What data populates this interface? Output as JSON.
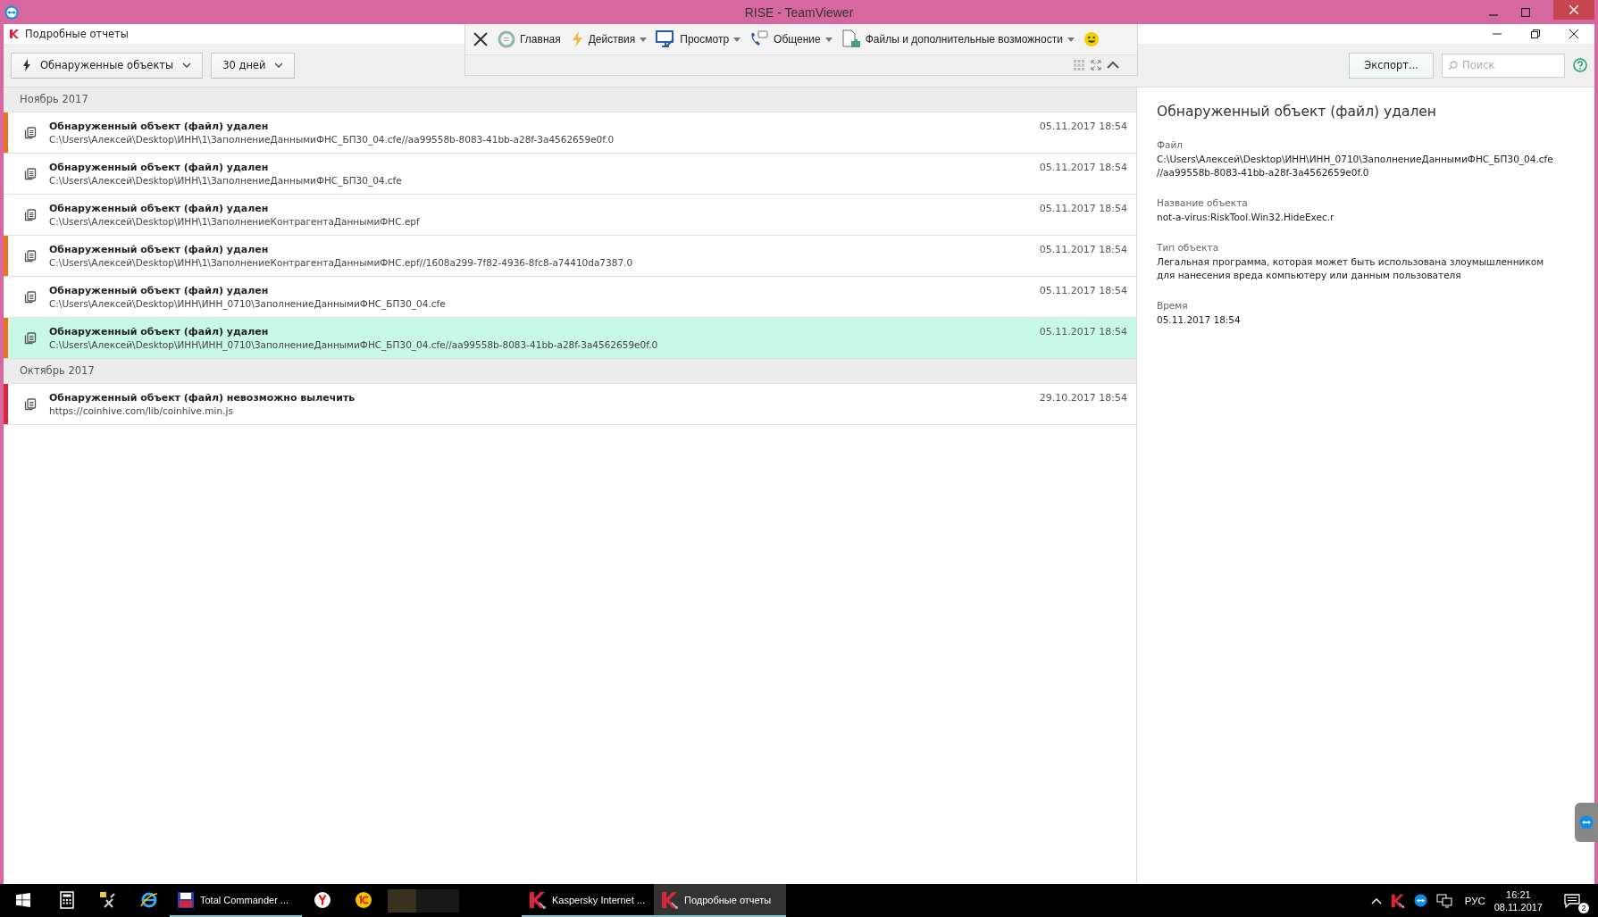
{
  "window": {
    "title": "RISE - TeamViewer"
  },
  "app": {
    "title": "Подробные отчеты"
  },
  "teamviewer_toolbar": {
    "items": [
      {
        "kind": "close"
      },
      {
        "kind": "home",
        "label": "Главная",
        "dropdown": false
      },
      {
        "kind": "actions",
        "label": "Действия",
        "dropdown": true
      },
      {
        "kind": "view",
        "label": "Просмотр",
        "dropdown": true
      },
      {
        "kind": "communicate",
        "label": "Общение",
        "dropdown": true
      },
      {
        "kind": "files",
        "label": "Файлы и дополнительные возможности",
        "dropdown": true
      },
      {
        "kind": "smiley"
      }
    ]
  },
  "filters": [
    {
      "kind": "type",
      "label": "Обнаруженные объекты"
    },
    {
      "kind": "period",
      "label": "30 дней"
    }
  ],
  "export_button": "Экспорт...",
  "search": {
    "placeholder": "Поиск"
  },
  "groups": [
    {
      "title": "Ноябрь 2017",
      "events": [
        {
          "title": "Обнаруженный объект (файл) удален",
          "path": "C:\\Users\\Алексей\\Desktop\\ИНН\\1\\ЗаполнениеДаннымиФНС_БП30_04.cfe//aa99558b-8083-41bb-a28f-3a4562659e0f.0",
          "time": "05.11.2017 18:54",
          "color": "#e8731a",
          "selected": false
        },
        {
          "title": "Обнаруженный объект (файл) удален",
          "path": "C:\\Users\\Алексей\\Desktop\\ИНН\\1\\ЗаполнениеДаннымиФНС_БП30_04.cfe",
          "time": "05.11.2017 18:54",
          "selected": false
        },
        {
          "title": "Обнаруженный объект (файл) удален",
          "path": "C:\\Users\\Алексей\\Desktop\\ИНН\\1\\ЗаполнениеКонтрагентаДаннымиФНС.epf",
          "time": "05.11.2017 18:54",
          "selected": false
        },
        {
          "title": "Обнаруженный объект (файл) удален",
          "path": "C:\\Users\\Алексей\\Desktop\\ИНН\\1\\ЗаполнениеКонтрагентаДаннымиФНС.epf//1608a299-7f82-4936-8fc8-a74410da7387.0",
          "time": "05.11.2017 18:54",
          "color": "#e8731a",
          "selected": false
        },
        {
          "title": "Обнаруженный объект (файл) удален",
          "path": "C:\\Users\\Алексей\\Desktop\\ИНН\\ИНН_0710\\ЗаполнениеДаннымиФНС_БП30_04.cfe",
          "time": "05.11.2017 18:54",
          "selected": false
        },
        {
          "title": "Обнаруженный объект (файл) удален",
          "path": "C:\\Users\\Алексей\\Desktop\\ИНН\\ИНН_0710\\ЗаполнениеДаннымиФНС_БП30_04.cfe//aa99558b-8083-41bb-a28f-3a4562659e0f.0",
          "time": "05.11.2017 18:54",
          "color": "#e8731a",
          "selected": true
        }
      ]
    },
    {
      "title": "Октябрь 2017",
      "events": [
        {
          "title": "Обнаруженный объект (файл) невозможно вылечить",
          "path": "https://coinhive.com/lib/coinhive.min.js",
          "time": "29.10.2017 18:54",
          "color": "#d7263d",
          "selected": false
        }
      ]
    }
  ],
  "details": {
    "title": "Обнаруженный объект (файл) удален",
    "fields": [
      {
        "label": "Файл",
        "value": "C:\\Users\\Алексей\\Desktop\\ИНН\\ИНН_0710\\ЗаполнениеДаннымиФНС_БП30_04.cfe//aa99558b-8083-41bb-a28f-3a4562659e0f.0"
      },
      {
        "label": "Название объекта",
        "value": "not-a-virus:RiskTool.Win32.HideExec.r"
      },
      {
        "label": "Тип объекта",
        "value": "Легальная программа, которая может быть использована злоумышленником для нанесения вреда компьютеру или данным пользователя"
      },
      {
        "label": "Время",
        "value": "05.11.2017 18:54"
      }
    ]
  },
  "taskbar": {
    "apps": [
      {
        "kind": "start"
      },
      {
        "kind": "calculator",
        "active": false
      },
      {
        "kind": "tools",
        "active": false
      },
      {
        "kind": "ie",
        "active": false
      },
      {
        "kind": "commander",
        "label": "Total Commander ...",
        "active": false
      },
      {
        "kind": "yandex",
        "active": false
      },
      {
        "kind": "onec",
        "active": false
      },
      {
        "kind": "blurred",
        "active": false
      },
      {
        "kind": "kaspersky",
        "label": "Kaspersky Internet ...",
        "active": false
      },
      {
        "kind": "kaspersky",
        "label": "Подробные отчеты",
        "active": true
      }
    ],
    "language": "РУС",
    "time": "16:21",
    "date": "08.11.2017",
    "notifications": "2"
  }
}
